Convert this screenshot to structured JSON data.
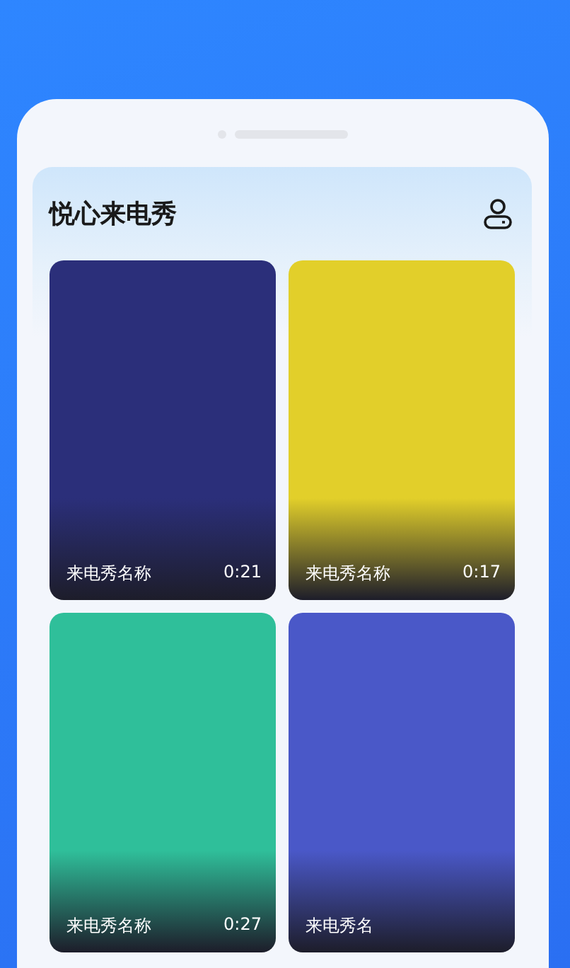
{
  "header": {
    "title": "悦心来电秀"
  },
  "cards": [
    {
      "name": "来电秀名称",
      "duration": "0:21",
      "color": "#2b2f7a"
    },
    {
      "name": "来电秀名称",
      "duration": "0:17",
      "color": "#e2cf2a"
    },
    {
      "name": "来电秀名称",
      "duration": "0:27",
      "color": "#2fbf9a"
    },
    {
      "name": "来电秀名",
      "color": "#4a58c8"
    }
  ]
}
